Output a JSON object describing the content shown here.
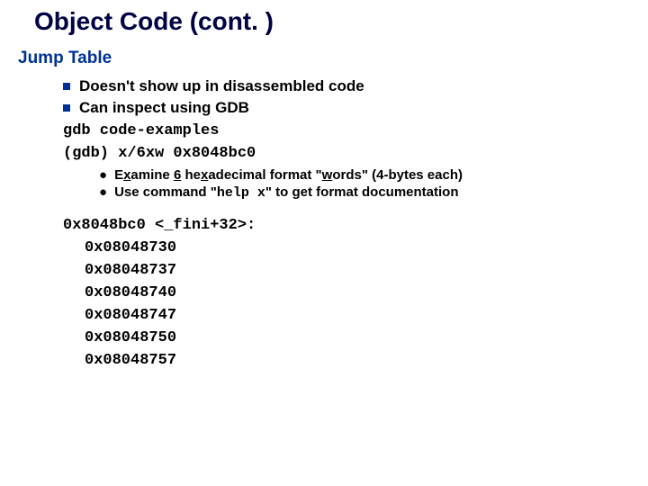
{
  "title": "Object Code (cont. )",
  "section": "Jump Table",
  "bullets": {
    "b1": "Doesn't show up in disassembled code",
    "b2": "Can inspect using GDB"
  },
  "code": {
    "line1": "gdb code-examples",
    "line2": "(gdb) x/6xw 0x8048bc0"
  },
  "sub": {
    "s1a": "E",
    "s1b": "x",
    "s1c": "amine ",
    "s1d": "6",
    "s1e": " he",
    "s1f": "x",
    "s1g": "adecimal format \"",
    "s1h": "w",
    "s1i": "ords\" (4-bytes each)",
    "s2a": "Use command \"",
    "s2b": "help x",
    "s2c": "\" to get format documentation"
  },
  "dump": {
    "head": "0x8048bc0 <_fini+32>:",
    "v1": "0x08048730",
    "v2": "0x08048737",
    "v3": "0x08048740",
    "v4": "0x08048747",
    "v5": "0x08048750",
    "v6": "0x08048757"
  }
}
